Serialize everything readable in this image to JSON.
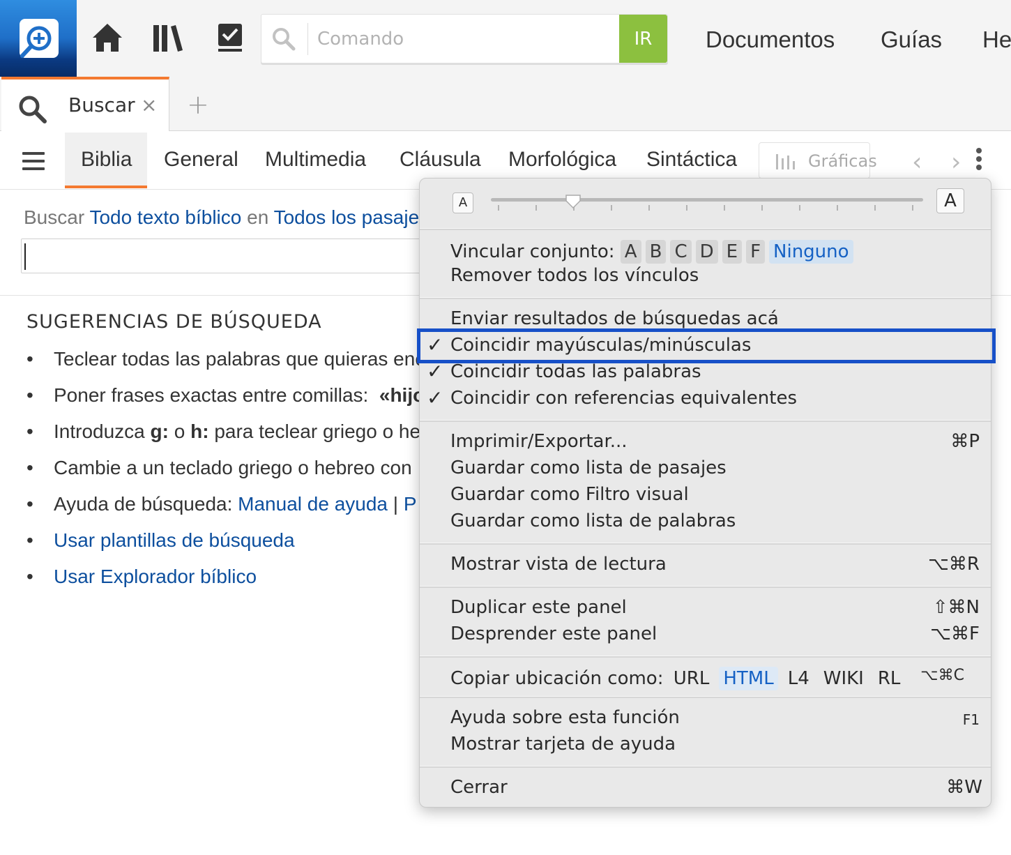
{
  "toolbar": {
    "command_placeholder": "Comando",
    "go_label": "IR",
    "nav": [
      "Documentos",
      "Guías",
      "He"
    ]
  },
  "tabs": {
    "active_label": "Buscar",
    "close_glyph": "×",
    "add_glyph": "+"
  },
  "search_types": {
    "items": [
      "Biblia",
      "General",
      "Multimedia",
      "Cláusula",
      "Morfológica",
      "Sintáctica"
    ],
    "active": "Biblia",
    "charts_label": "Gráficas"
  },
  "form": {
    "prefix": "Buscar",
    "scope_link": "Todo texto bíblico",
    "in_word": "en",
    "range_link": "Todos los pasajes",
    "query_value": ""
  },
  "suggestions": {
    "title": "SUGERENCIAS DE BÚSQUEDA",
    "items": [
      "Teclear todas las palabras que quieras encontrar",
      "Poner frases exactas entre comillas:",
      "Introduzca",
      "Cambie a un teclado griego o hebreo con",
      "Ayuda de búsqueda:"
    ],
    "quote_example": "«hijo",
    "intro_g": "g:",
    "intro_o": "o",
    "intro_h": "h:",
    "intro_rest": "para teclear griego o hebreo",
    "help_link_manual": "Manual de ayuda",
    "help_sep": "|",
    "help_link_p": "P",
    "template_link": "Usar plantillas de búsqueda",
    "explorer_link": "Usar Explorador bíblico"
  },
  "menu": {
    "font_small": "A",
    "font_large": "A",
    "link_set_label": "Vincular conjunto:",
    "link_sets": [
      "A",
      "B",
      "C",
      "D",
      "E",
      "F"
    ],
    "link_set_selected": "Ninguno",
    "remove_links": "Remover todos los vínculos",
    "send_results": "Enviar resultados de búsquedas acá",
    "match_case": "Coincidir mayúsculas/minúsculas",
    "match_all_words": "Coincidir todas las palabras",
    "match_equiv_refs": "Coincidir con referencias equivalentes",
    "check_glyph": "✓",
    "print_export": "Imprimir/Exportar...",
    "print_shortcut": "⌘P",
    "save_passage_list": "Guardar como lista de pasajes",
    "save_visual_filter": "Guardar como Filtro visual",
    "save_word_list": "Guardar como lista de palabras",
    "reading_view": "Mostrar vista de lectura",
    "reading_shortcut": "⌥⌘R",
    "duplicate_panel": "Duplicar este panel",
    "duplicate_shortcut": "⇧⌘N",
    "detach_panel": "Desprender este panel",
    "detach_shortcut": "⌥⌘F",
    "copy_location_label": "Copiar ubicación como:",
    "copy_formats": [
      "URL",
      "HTML",
      "L4",
      "WIKI",
      "RL"
    ],
    "copy_format_selected": "HTML",
    "copy_shortcut": "⌥⌘C",
    "help_feature": "Ayuda sobre esta función",
    "help_shortcut": "F1",
    "help_card": "Mostrar tarjeta de ayuda",
    "close": "Cerrar",
    "close_shortcut": "⌘W"
  },
  "colors": {
    "accent_orange": "#f47a31",
    "go_green": "#8cc03f",
    "link_blue": "#0d4f9e",
    "highlight_box": "#1750c8"
  }
}
